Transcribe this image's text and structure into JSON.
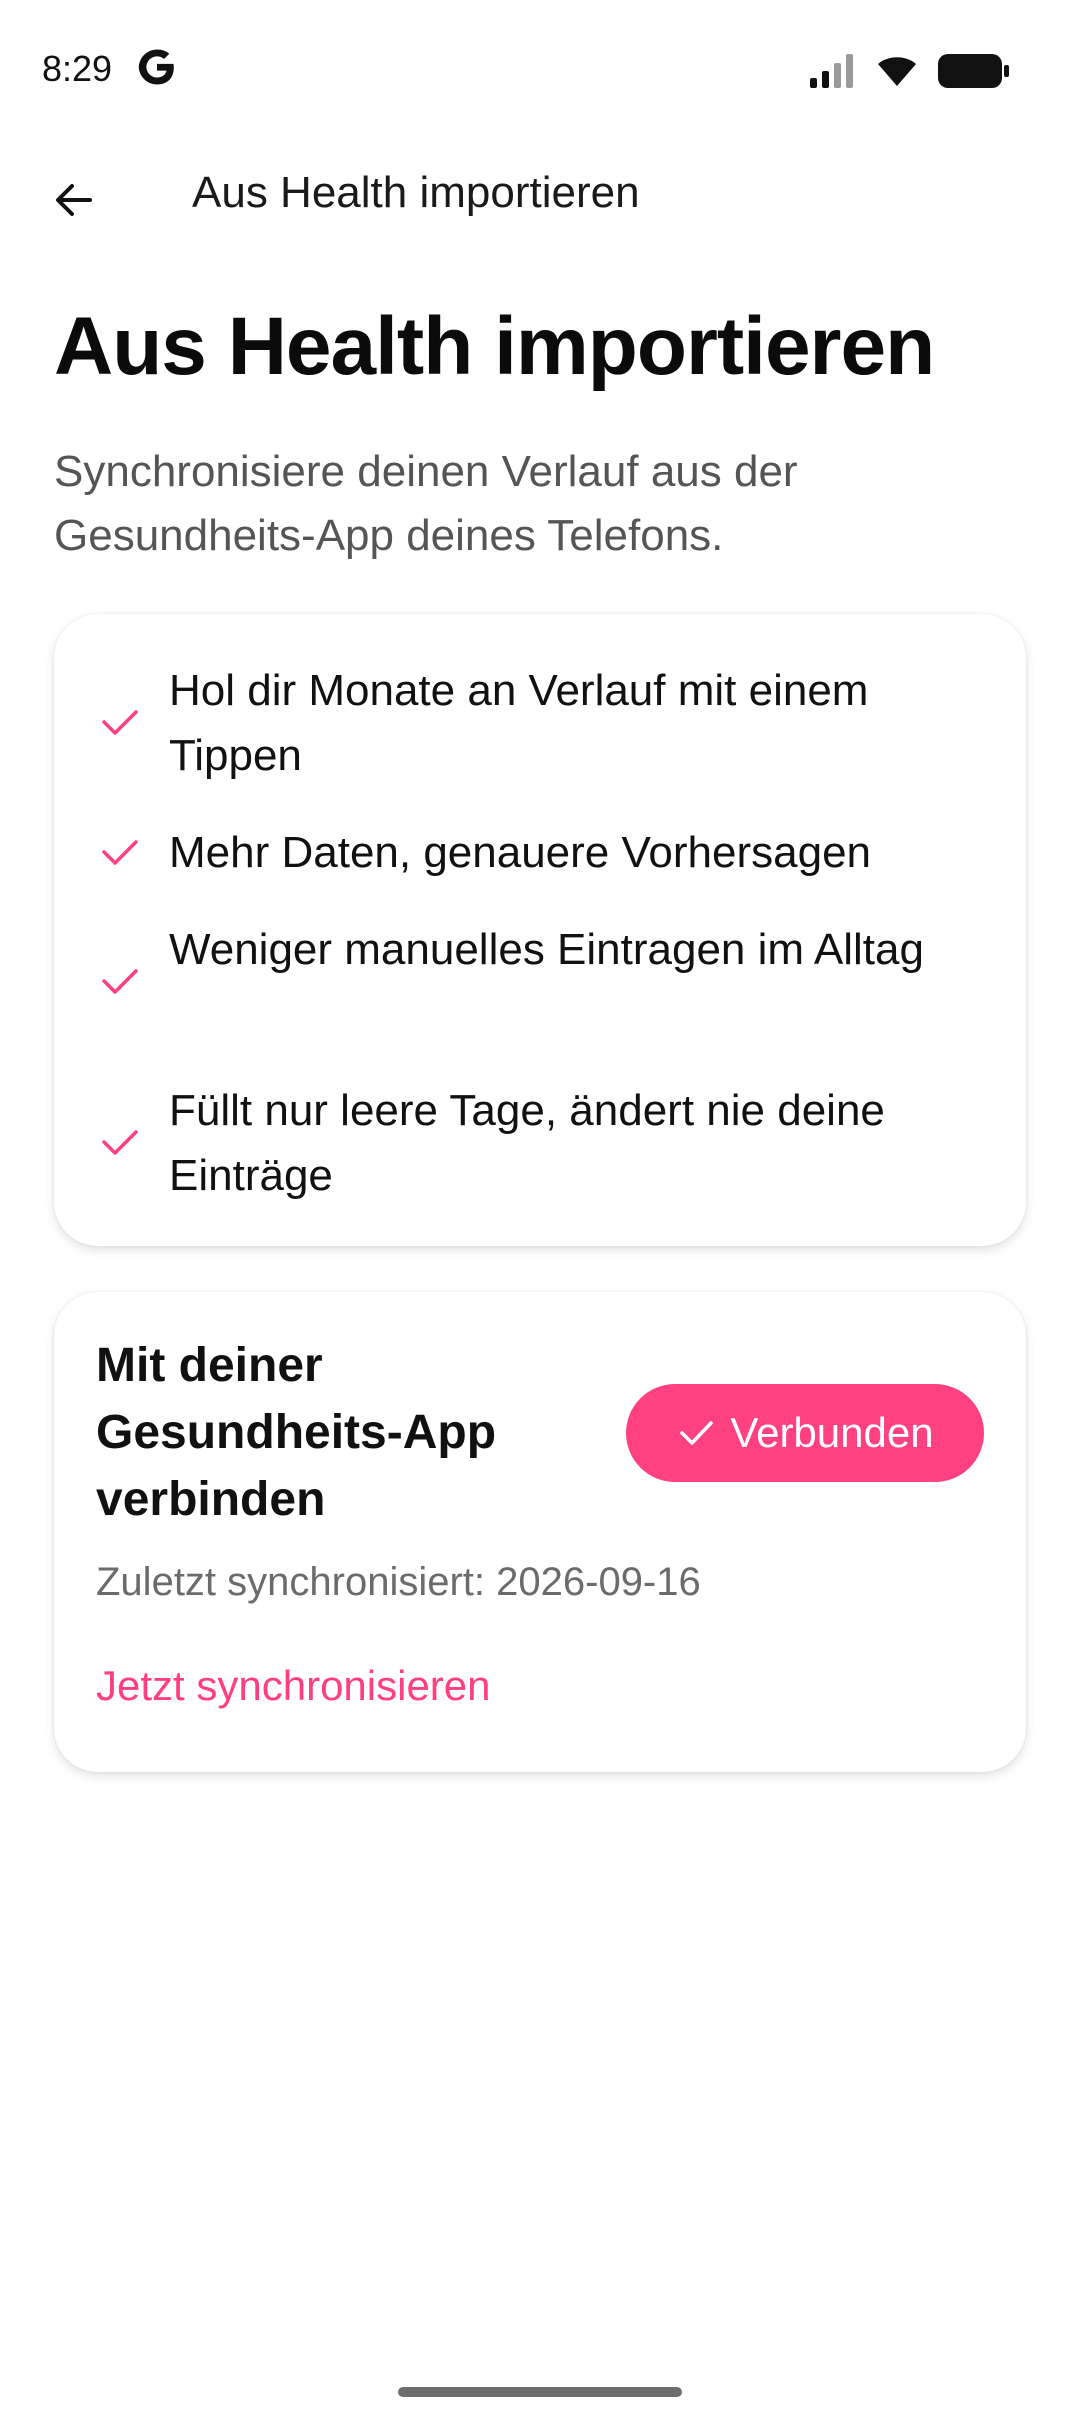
{
  "status_bar": {
    "time": "8:29",
    "icons": [
      "google-g-icon",
      "signal-icon",
      "wifi-icon",
      "battery-icon"
    ]
  },
  "app_bar": {
    "title": "Aus Health importieren",
    "back_icon": "arrow-left-icon"
  },
  "page": {
    "title": "Aus Health importieren",
    "subtitle": "Synchronisiere deinen Verlauf aus der Gesundheits-App deines Telefons."
  },
  "benefits": {
    "items": [
      {
        "text": "Hol dir Monate an Verlauf mit einem Tippen"
      },
      {
        "text": "Mehr Daten, genauere Vorhersagen"
      },
      {
        "text": "Weniger manuelles Eintragen im Alltag"
      },
      {
        "text": "Füllt nur leere Tage, ändert nie deine Einträge"
      }
    ]
  },
  "connect": {
    "title": "Mit deiner Gesundheits-App verbinden",
    "status_label": "Verbunden",
    "last_sync": "Zuletzt synchronisiert: 2026-09-16",
    "sync_now_label": "Jetzt synchronisieren"
  },
  "colors": {
    "accent": "#ff4081",
    "text_primary": "#111111",
    "text_secondary": "#6b6b6b"
  }
}
